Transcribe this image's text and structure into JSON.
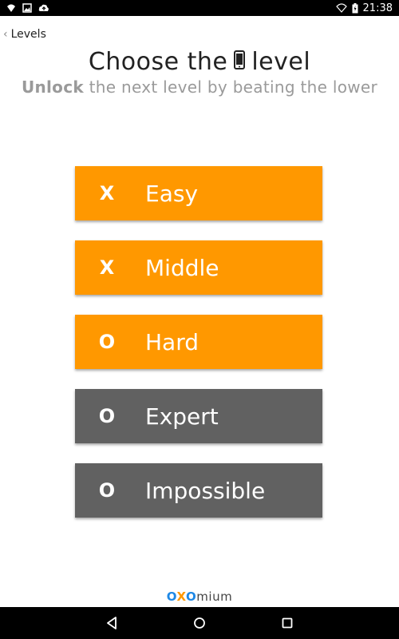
{
  "status_bar": {
    "time": "21:38",
    "left_icons": [
      "wifi-question-icon",
      "image-icon",
      "cloud-upload-icon"
    ],
    "right_icons": [
      "wifi-icon",
      "battery-charging-icon"
    ]
  },
  "nav": {
    "back_label": "Levels"
  },
  "header": {
    "title_before": "Choose the",
    "title_after": "level",
    "title_icon": "phone-icon",
    "subtitle_bold": "Unlock",
    "subtitle_rest": " the next level by beating the lower"
  },
  "levels": [
    {
      "mark": "X",
      "name": "Easy",
      "color": "#ff9800"
    },
    {
      "mark": "X",
      "name": "Middle",
      "color": "#ff9800"
    },
    {
      "mark": "O",
      "name": "Hard",
      "color": "#ff9800"
    },
    {
      "mark": "O",
      "name": "Expert",
      "color": "#616161"
    },
    {
      "mark": "O",
      "name": "Impossible",
      "color": "#616161"
    }
  ],
  "brand": {
    "part1": "O",
    "part2": "X",
    "part3": "O",
    "part4": "mium"
  },
  "colors": {
    "unlocked": "#ff9800",
    "locked": "#616161",
    "brand_blue": "#1e88e5"
  }
}
